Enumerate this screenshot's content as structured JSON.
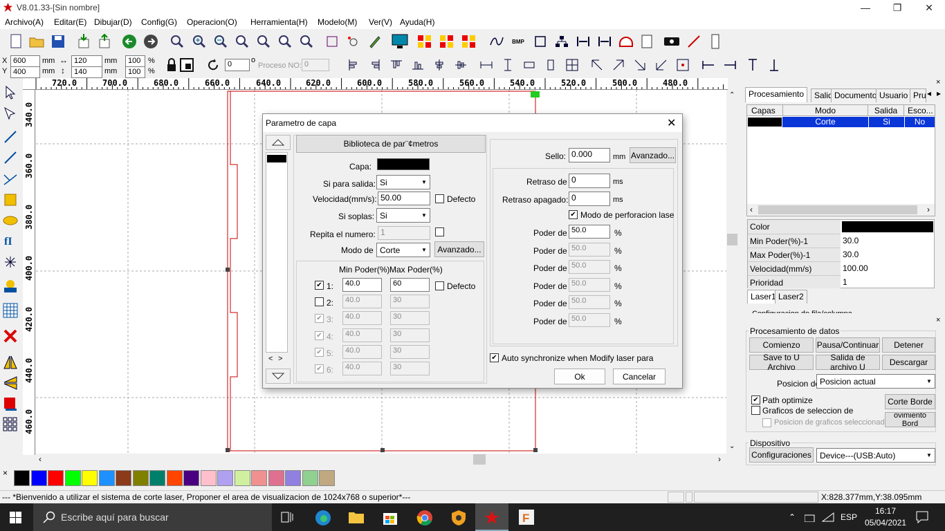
{
  "window": {
    "title": "V8.01.33-[Sin nombre]"
  },
  "menu": [
    "Archivo(A)",
    "Editar(E)",
    "Dibujar(D)",
    "Config(G)",
    "Operacion(O)",
    "Herramienta(H)",
    "Modelo(M)",
    "Ver(V)",
    "Ayuda(H)"
  ],
  "coords": {
    "x_label": "X",
    "y_label": "Y",
    "x": "600",
    "y": "400",
    "unit": "mm",
    "w": "120",
    "h": "140",
    "pw": "100",
    "ph": "100",
    "pct": "%",
    "rotate": "0",
    "deg": "o",
    "proceso_label": "Proceso NO:",
    "proceso": "0"
  },
  "ruler_top": [
    "720.0",
    "700.0",
    "680.0",
    "660.0",
    "640.0",
    "620.0",
    "600.0",
    "580.0",
    "560.0",
    "540.0",
    "520.0",
    "500.0",
    "480.0"
  ],
  "ruler_left": [
    "340.0",
    "360.0",
    "380.0",
    "400.0",
    "420.0",
    "440.0",
    "460.0"
  ],
  "right": {
    "tabs": [
      "Procesamiento",
      "Salida",
      "Documento",
      "Usuario",
      "Pru"
    ],
    "layer_headers": [
      "Capas",
      "Modo",
      "Salida",
      "Esco..."
    ],
    "layer_row": {
      "mode": "Corte",
      "salida": "Si",
      "esco": "No"
    },
    "props": [
      {
        "k": "Color",
        "v": ""
      },
      {
        "k": "Min Poder(%)-1",
        "v": "30.0"
      },
      {
        "k": "Max Poder(%)-1",
        "v": "30.0"
      },
      {
        "k": "Velocidad(mm/s)",
        "v": "100.00"
      },
      {
        "k": "Prioridad",
        "v": "1"
      }
    ],
    "laser_tabs": [
      "Laser1",
      "Laser2"
    ],
    "cut_text": "Configuracion de fila/columna",
    "data_group": "Procesamiento de datos",
    "btn_start": "Comienzo",
    "btn_pause": "Pausa/Continuar",
    "btn_stop": "Detener",
    "btn_save_u": "Save to U Archivo",
    "btn_out_u": "Salida de archivo U",
    "btn_download": "Descargar",
    "pos_label": "Posicion de",
    "pos_value": "Posicion actual",
    "path_opt": "Path optimize",
    "graf_sel": "Graficos de seleccion de",
    "pos_graf": "Posicion de graficos seleccionados",
    "btn_border": "Corte Borde",
    "btn_move_border": "ovimiento Bord",
    "device_group": "Dispositivo",
    "btn_config": "Configuraciones",
    "device_value": "Device---(USB:Auto)"
  },
  "palette": [
    "#000000",
    "#0000ff",
    "#ff0000",
    "#00ff00",
    "#ffff00",
    "#1e90ff",
    "#8b3a1a",
    "#808000",
    "#00806a",
    "#ff4500",
    "#4b0082",
    "#ffc0cb",
    "#b0a0f0",
    "#d0f0a0",
    "#f09090",
    "#e07090",
    "#9080e0",
    "#90d090",
    "#c0a880"
  ],
  "status": {
    "msg": "--- *Bienvenido a utilizar el sistema de corte laser, Proponer el area de visualizacion de 1024x768 o superior*---",
    "coord": "X:828.377mm,Y:38.095mm"
  },
  "taskbar": {
    "search": "Escribe aquí para buscar",
    "lang": "ESP",
    "time": "16:17",
    "date": "05/04/2021"
  },
  "dialog": {
    "title": "Parametro de capa",
    "lib_btn": "Biblioteca de par¨¢metros",
    "capa": "Capa:",
    "salida_label": "Si para salida:",
    "salida": "Si",
    "vel_label": "Velocidad(mm/s):",
    "vel": "50.00",
    "defecto": "Defecto",
    "soplas_label": "Si soplas:",
    "soplas": "Si",
    "repite_label": "Repita el numero:",
    "repite": "1",
    "modo_label": "Modo de",
    "modo": "Corte",
    "avanzado": "Avanzado...",
    "min_hdr": "Min Poder(%)",
    "max_hdr": "Max Poder(%)",
    "powers": [
      {
        "n": "1:",
        "min": "40.0",
        "max": "60",
        "checked": "✔"
      },
      {
        "n": "2:",
        "min": "40.0",
        "max": "30",
        "checked": ""
      },
      {
        "n": "3:",
        "min": "40.0",
        "max": "30",
        "checked": "✔"
      },
      {
        "n": "4:",
        "min": "40.0",
        "max": "30",
        "checked": "✔"
      },
      {
        "n": "5:",
        "min": "40.0",
        "max": "30",
        "checked": "✔"
      },
      {
        "n": "6:",
        "min": "40.0",
        "max": "30",
        "checked": "✔"
      }
    ],
    "sello_label": "Sello:",
    "sello": "0.000",
    "mm": "mm",
    "avanzado2": "Avanzado...",
    "retraso_label": "Retraso de",
    "retraso": "0",
    "ms": "ms",
    "retraso_ap_label": "Retraso apagado:",
    "retraso_ap": "0",
    "perf_label": "Modo de perforacion lase",
    "poder_label": "Poder de",
    "poder": [
      "50.0",
      "50.0",
      "50.0",
      "50.0",
      "50.0",
      "50.0"
    ],
    "pct": "%",
    "auto_sync": "Auto synchronize when Modify laser para",
    "ok": "Ok",
    "cancel": "Cancelar"
  }
}
